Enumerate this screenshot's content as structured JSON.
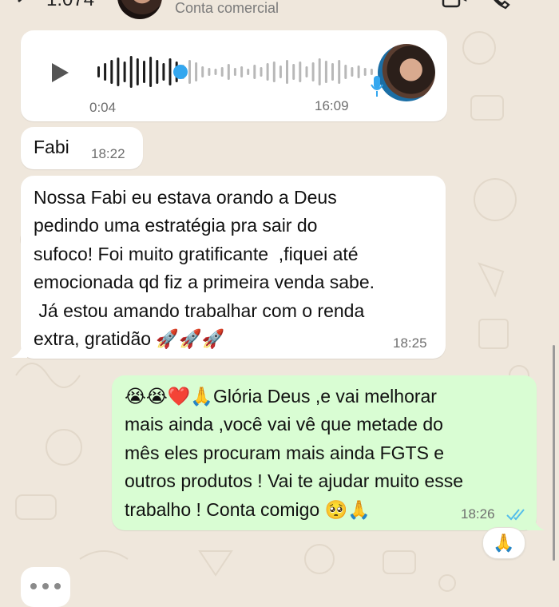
{
  "header": {
    "count": "1.074",
    "subtitle": "Conta comercial"
  },
  "voice_message": {
    "duration": "0:04",
    "time": "16:09",
    "progress_fraction": 0.3
  },
  "messages": [
    {
      "direction": "incoming",
      "text": "Fabi",
      "time": "18:22"
    },
    {
      "direction": "incoming",
      "text": "Nossa Fabi eu estava orando a Deus\npedindo uma estratégia pra sair do\nsufoco! Foi muito gratificante  ,fiquei até\nemocionada qd fiz a primeira venda sabe.\n Já estou amando trabalhar com o renda\nextra, gratidão 🚀🚀🚀",
      "time": "18:25"
    },
    {
      "direction": "outgoing",
      "text": "😭😭❤️🙏Glória Deus ,e vai melhorar\nmais ainda ,você vai vê que metade do\nmês eles procuram mais ainda FGTS e\noutros produtos ! Vai te ajudar muito esse\ntrabalho ! Conta comigo 🥺🙏",
      "time": "18:26",
      "status": "read"
    }
  ],
  "reaction": {
    "emoji": "🙏"
  },
  "colors": {
    "wallpaper": "#efe7dc",
    "incoming_bubble": "#ffffff",
    "outgoing_bubble": "#d9fdd3",
    "read_ticks": "#53bdeb",
    "waveform_played": "#1c1c1c",
    "waveform_unplayed": "#b8b8b8",
    "progress_dot": "#34a7ef"
  },
  "icons": [
    "back-chevron-icon",
    "video-call-icon",
    "phone-icon",
    "play-icon",
    "microphone-icon",
    "double-check-icon"
  ]
}
